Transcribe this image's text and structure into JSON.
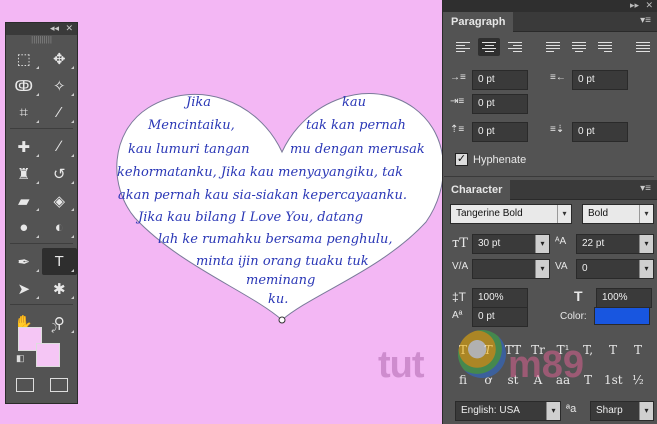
{
  "poem": [
    "Jika",
    "kau",
    "Mencintaiku,",
    "tak kan pernah",
    "kau lumuri tangan",
    "mu dengan merusak",
    "kehormatanku, Jika kau menyayangiku, tak",
    "akan pernah kau sia-siakan kepercayaanku.",
    "Jika kau bilang I Love You, datang",
    "lah ke rumahku bersama penghulu,",
    "minta ijin orang tuaku tuk",
    "meminang",
    "ku."
  ],
  "watermark": {
    "part1": "tut",
    "part2": "m89"
  },
  "tools": {
    "rows": [
      [
        "marquee-icon",
        "move-icon"
      ],
      [
        "lasso-icon",
        "magic-wand-icon"
      ],
      [
        "crop-icon",
        "eyedropper-icon"
      ],
      [
        "healing-icon",
        "brush-icon"
      ],
      [
        "stamp-icon",
        "history-brush-icon"
      ],
      [
        "eraser-icon",
        "paint-bucket-icon"
      ],
      [
        "blur-icon",
        "dodge-icon"
      ],
      [
        "pen-icon",
        "type-icon"
      ],
      [
        "path-select-icon",
        "shape-icon"
      ],
      [
        "hand-icon",
        "zoom-icon"
      ]
    ],
    "glyphs": {
      "marquee-icon": "⬚",
      "move-icon": "✥",
      "lasso-icon": "ↂ",
      "magic-wand-icon": "✧",
      "crop-icon": "⌗",
      "eyedropper-icon": "⁄",
      "healing-icon": "✚",
      "brush-icon": "∕",
      "stamp-icon": "♜",
      "history-brush-icon": "↺",
      "eraser-icon": "▰",
      "paint-bucket-icon": "◈",
      "blur-icon": "●",
      "dodge-icon": "◐",
      "pen-icon": "✒",
      "type-icon": "T",
      "path-select-icon": "➤",
      "shape-icon": "✱",
      "hand-icon": "✋",
      "zoom-icon": "⚲"
    },
    "active": "type-icon",
    "fg_color": "#f5c6f5",
    "bg_color": "#f5c6f5"
  },
  "paragraph": {
    "title": "Paragraph",
    "indent_left": "0 pt",
    "indent_right": "0 pt",
    "indent_first": "0 pt",
    "space_before": "0 pt",
    "space_after": "0 pt",
    "hyphenate_label": "Hyphenate",
    "hyphenate_checked": "✓"
  },
  "character": {
    "title": "Character",
    "font_family": "Tangerine Bold",
    "font_style": "Bold",
    "font_size": "30 pt",
    "leading": "22 pt",
    "kerning": "",
    "tracking": "0",
    "vertical_scale": "100%",
    "horizontal_scale": "100%",
    "baseline_shift": "0 pt",
    "color_label": "Color:",
    "color": "#1856e0",
    "style_buttons": [
      "T",
      "T",
      "TT",
      "Tr",
      "T¹",
      "T,",
      "T",
      "T"
    ],
    "opentype_buttons": [
      "fi",
      "ơ",
      "st",
      "A",
      "aa",
      "T",
      "1st",
      "½"
    ],
    "language": "English: USA",
    "aa_icon": "ªa",
    "antialias": "Sharp"
  }
}
